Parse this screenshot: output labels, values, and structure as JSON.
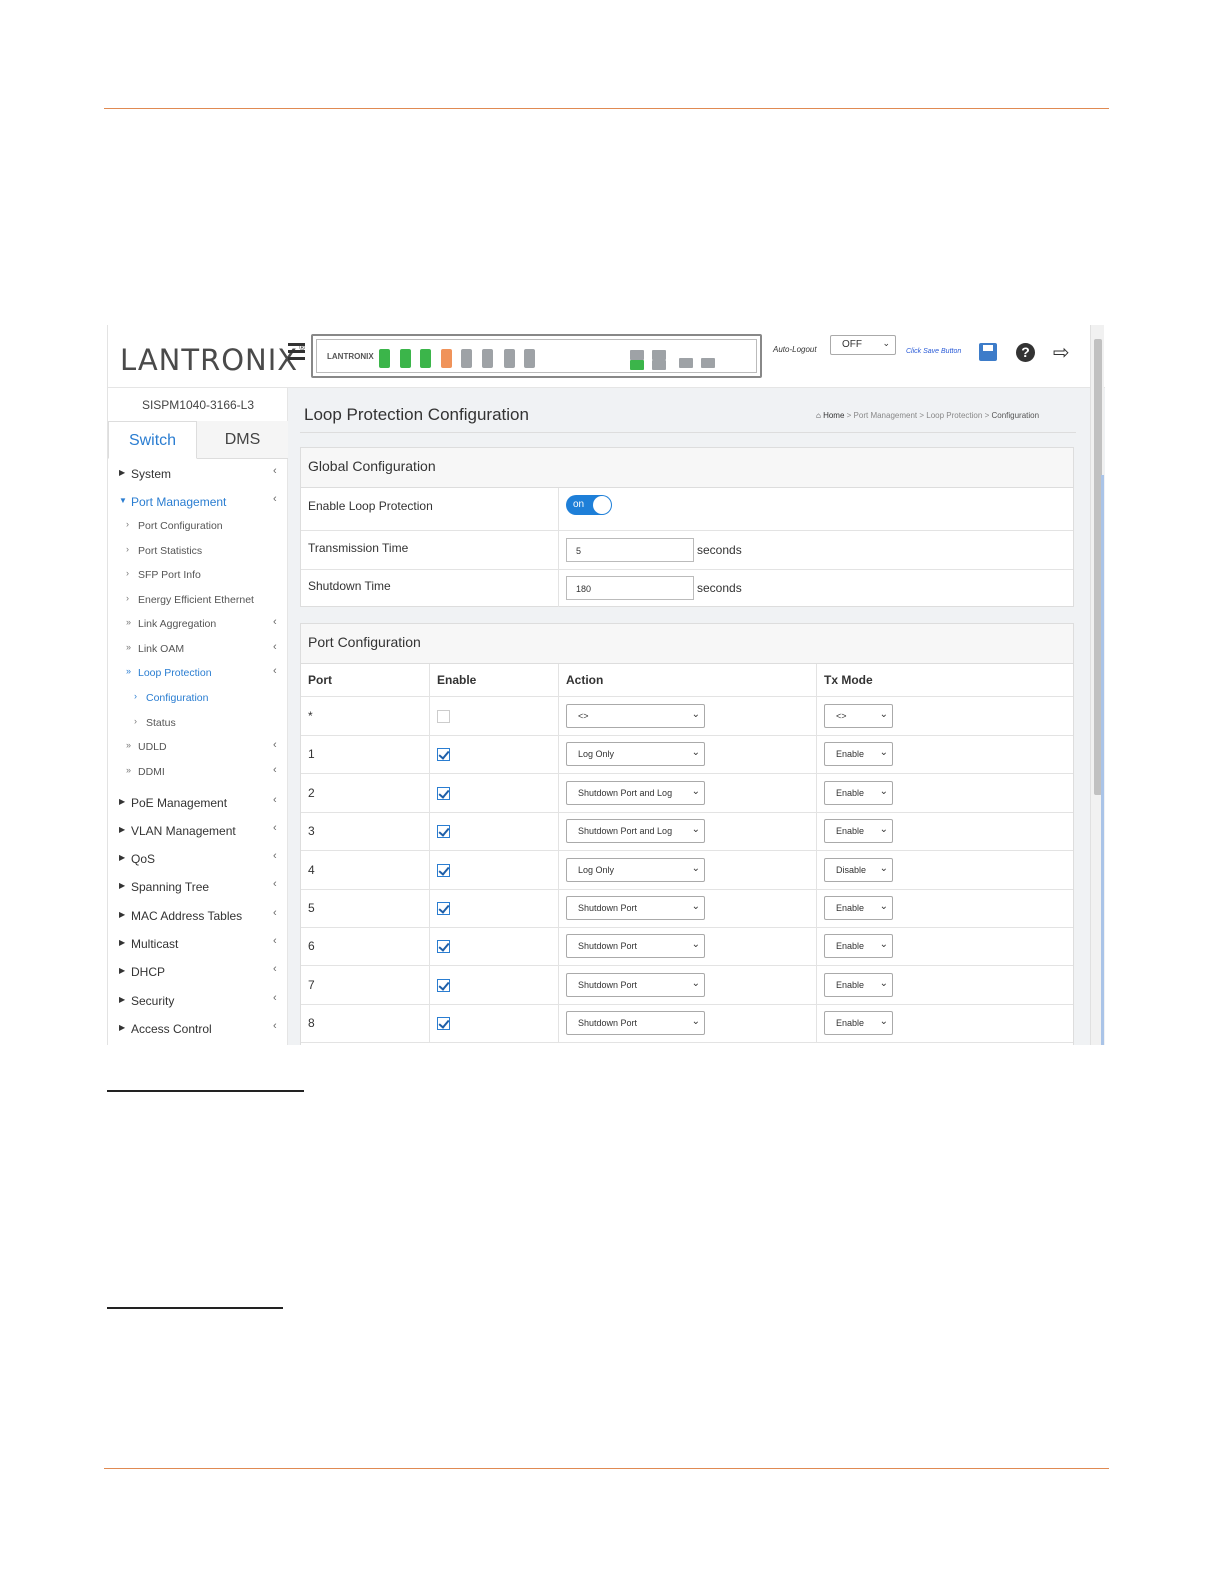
{
  "header": {
    "logo": "LANTRONIX",
    "logo_mark": "®",
    "panel_brand": "LANTRONIX",
    "autologout_label": "Auto-Logout",
    "autologout_value": "OFF",
    "save_hint": "Click Save Button"
  },
  "icons": {
    "menu": "hamburger-icon",
    "save": "floppy-disk-icon",
    "help": "question-circle-icon",
    "logout": "sign-out-icon"
  },
  "sidebar": {
    "device": "SISPM1040-3166-L3",
    "tabs": [
      "Switch",
      "DMS"
    ],
    "top_items": [
      {
        "label": "System"
      }
    ],
    "port_management": {
      "label": "Port Management",
      "children": [
        "Port Configuration",
        "Port Statistics",
        "SFP Port Info",
        "Energy Efficient Ethernet",
        "Link Aggregation",
        "Link OAM",
        "Loop Protection",
        "Configuration",
        "Status",
        "UDLD",
        "DDMI"
      ]
    },
    "bottom_items": [
      "PoE Management",
      "VLAN Management",
      "QoS",
      "Spanning Tree",
      "MAC Address Tables",
      "Multicast",
      "DHCP",
      "Security",
      "Access Control"
    ]
  },
  "page": {
    "title": "Loop Protection Configuration",
    "breadcrumb": {
      "home": "Home",
      "sep": ">",
      "items": [
        "Port Management",
        "Loop Protection"
      ],
      "current": "Configuration"
    }
  },
  "global_config": {
    "heading": "Global Configuration",
    "enable_label": "Enable Loop Protection",
    "enable_toggle": "on",
    "tx_label": "Transmission Time",
    "tx_value": "5",
    "tx_unit": "seconds",
    "shutdown_label": "Shutdown Time",
    "shutdown_value": "180",
    "shutdown_unit": "seconds"
  },
  "port_config": {
    "heading": "Port Configuration",
    "columns": [
      "Port",
      "Enable",
      "Action",
      "Tx Mode"
    ],
    "rows": [
      {
        "port": "*",
        "enabled": false,
        "action": "<>",
        "tx_mode": "<>"
      },
      {
        "port": "1",
        "enabled": true,
        "action": "Log Only",
        "tx_mode": "Enable"
      },
      {
        "port": "2",
        "enabled": true,
        "action": "Shutdown Port and Log",
        "tx_mode": "Enable"
      },
      {
        "port": "3",
        "enabled": true,
        "action": "Shutdown Port and Log",
        "tx_mode": "Enable"
      },
      {
        "port": "4",
        "enabled": true,
        "action": "Log Only",
        "tx_mode": "Disable"
      },
      {
        "port": "5",
        "enabled": true,
        "action": "Shutdown Port",
        "tx_mode": "Enable"
      },
      {
        "port": "6",
        "enabled": true,
        "action": "Shutdown Port",
        "tx_mode": "Enable"
      },
      {
        "port": "7",
        "enabled": true,
        "action": "Shutdown Port",
        "tx_mode": "Enable"
      },
      {
        "port": "8",
        "enabled": true,
        "action": "Shutdown Port",
        "tx_mode": "Enable"
      }
    ]
  },
  "colors": {
    "accent": "#2a7dd1",
    "rule": "#e08a52",
    "port_green": "#3bb54a",
    "port_orange": "#f0935a"
  }
}
